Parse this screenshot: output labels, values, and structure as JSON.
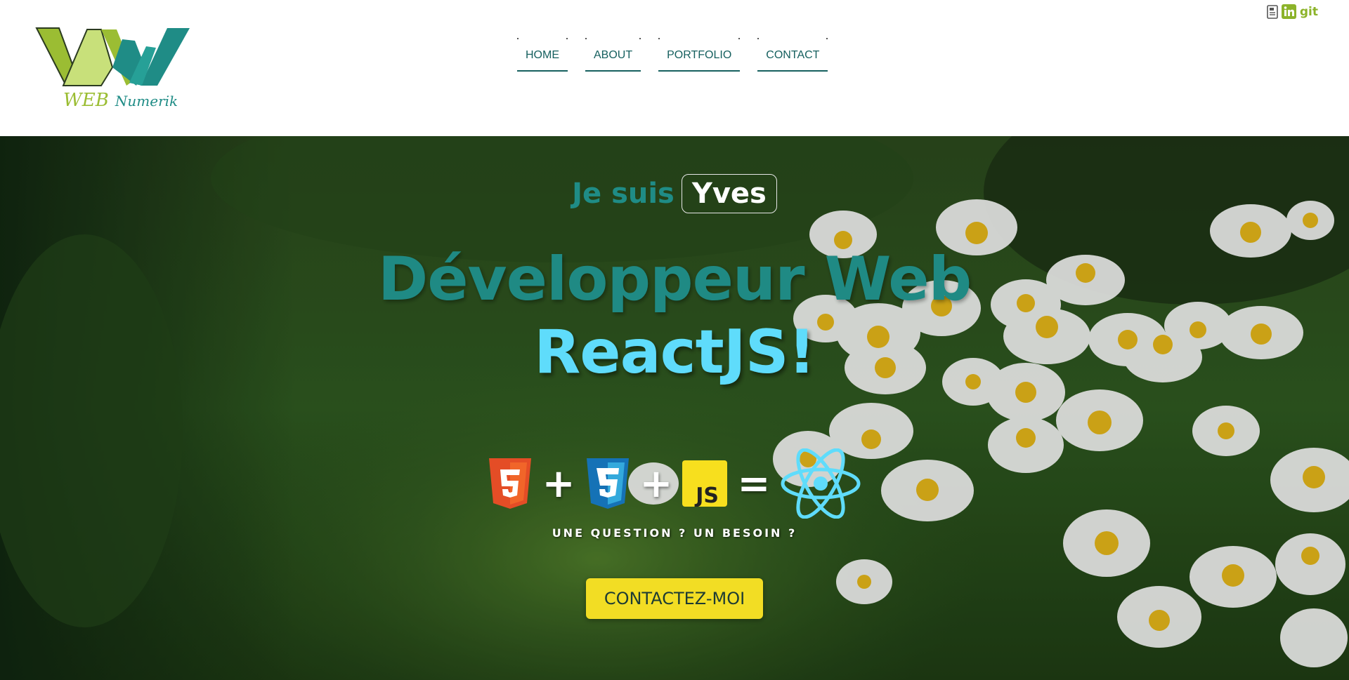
{
  "brand": {
    "word1": "WEB",
    "word2": "Numerik",
    "colors": {
      "lime": "#9bbd33",
      "teal": "#1f8c86"
    }
  },
  "nav": {
    "items": [
      {
        "label": "HOME"
      },
      {
        "label": "ABOUT"
      },
      {
        "label": "PORTFOLIO"
      },
      {
        "label": "CONTACT"
      }
    ]
  },
  "socials": {
    "cv_icon": "document-icon",
    "linkedin_icon": "linkedin-icon",
    "git_label": "git"
  },
  "hero": {
    "intro_prefix": "Je suis",
    "intro_name": "Yves",
    "headline_line1": "Développeur Web",
    "headline_line2": "ReactJS!",
    "stack": {
      "html": "html5-icon",
      "plus1": "+",
      "css": "css3-icon",
      "plus2": "+",
      "js": "javascript-icon",
      "js_label": "JS",
      "equals": "=",
      "react": "react-icon"
    },
    "question": "UNE QUESTION ? UN BESOIN ?",
    "cta_label": "CONTACTEZ-MOI"
  },
  "colors": {
    "teal_heading": "#1f8a84",
    "react_cyan": "#5fdcfb",
    "cta_yellow": "#f2dd24",
    "nav_text": "#16605f"
  }
}
